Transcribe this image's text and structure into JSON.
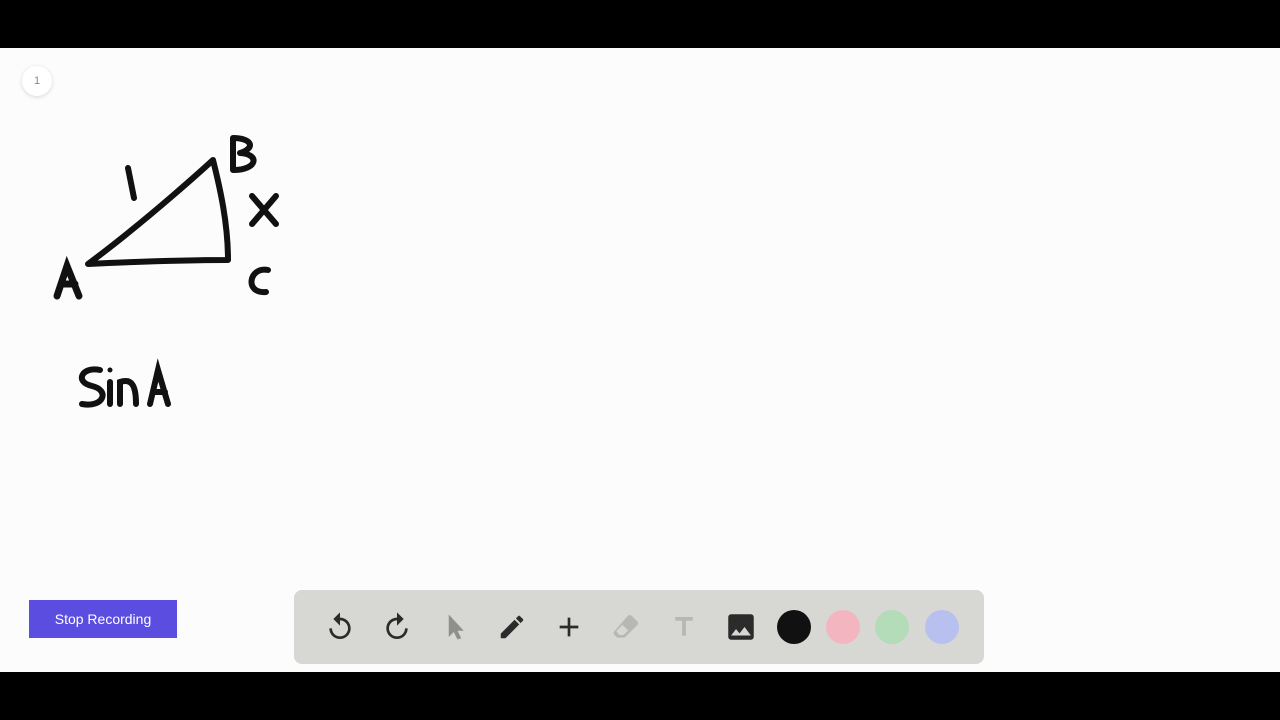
{
  "page_badge": "1",
  "stop_button_label": "Stop Recording",
  "colors": {
    "accent": "#5b4de0",
    "toolbar_bg": "#d7d7d4",
    "ink": "#111111"
  },
  "swatches": {
    "black": "#111111",
    "pink": "#f3b6c0",
    "green": "#b4dcb9",
    "purple": "#b8c0f0"
  },
  "toolbar": {
    "undo": "undo-icon",
    "redo": "redo-icon",
    "pointer": "pointer-icon",
    "pen": "pen-icon",
    "add": "plus-icon",
    "eraser": "eraser-icon",
    "text": "text-icon",
    "image": "image-icon"
  },
  "drawing": {
    "labels": {
      "A": "A",
      "B": "B",
      "C": "C",
      "x": "X",
      "hyp": "1"
    },
    "equation": "Sin A"
  }
}
